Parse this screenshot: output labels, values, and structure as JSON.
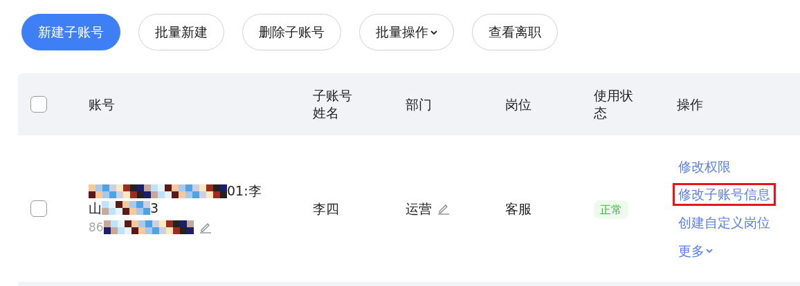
{
  "toolbar": [
    {
      "label": "新建子账号",
      "kind": "primary"
    },
    {
      "label": "批量新建",
      "kind": "plain"
    },
    {
      "label": "删除子账号",
      "kind": "plain"
    },
    {
      "label": "批量操作",
      "kind": "dropdown"
    },
    {
      "label": "查看离职",
      "kind": "plain"
    }
  ],
  "table": {
    "select_all": {
      "checked": false
    },
    "columns": [
      "账号",
      "子账号姓名",
      "部门",
      "岗位",
      "使用状态",
      "操作"
    ],
    "rows": [
      {
        "checked": false,
        "account_line1_end": "01:李",
        "account_line2_start": "山",
        "account_line2_end": "3",
        "phone_start": "86",
        "name": "李四",
        "department": "运营",
        "position": "客服",
        "status": {
          "label": "正常",
          "kind": "normal"
        },
        "actions": [
          {
            "label": "修改权限",
            "highlighted": false,
            "kind": "link"
          },
          {
            "label": "修改子账号信息",
            "highlighted": true,
            "kind": "link"
          },
          {
            "label": "创建自定义岗位",
            "highlighted": false,
            "kind": "link"
          },
          {
            "label": "更多",
            "highlighted": false,
            "kind": "dropdown"
          }
        ]
      }
    ]
  }
}
